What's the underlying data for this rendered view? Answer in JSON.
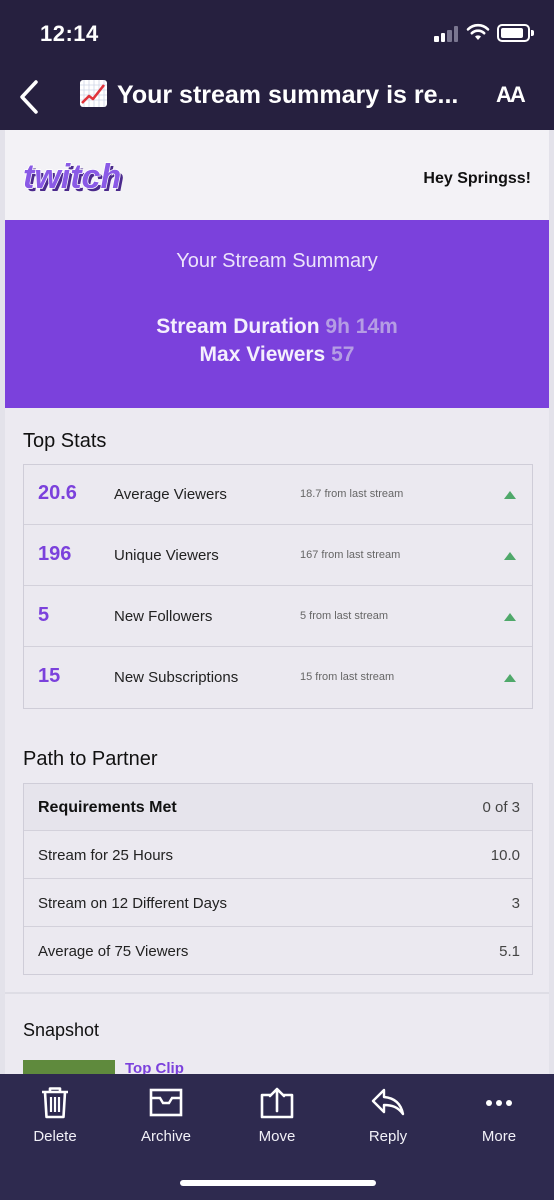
{
  "status_bar": {
    "time": "12:14"
  },
  "header": {
    "subject": "Your stream summary is re...",
    "subject_icon": "chart-increasing-emoji",
    "text_size_label": "AA"
  },
  "email": {
    "logo_name": "twitch-logo",
    "logo_text": "twitch",
    "greeting": "Hey Springss!",
    "hero": {
      "title": "Your Stream Summary",
      "duration_label": "Stream Duration",
      "duration_value": "9h 14m",
      "max_viewers_label": "Max Viewers",
      "max_viewers_value": "57"
    },
    "top_stats_title": "Top Stats",
    "top_stats": [
      {
        "value": "20.6",
        "label": "Average Viewers",
        "previous": "18.7 from last stream",
        "trend": "up"
      },
      {
        "value": "196",
        "label": "Unique Viewers",
        "previous": "167 from last stream",
        "trend": "up"
      },
      {
        "value": "5",
        "label": "New Followers",
        "previous": "5 from last stream",
        "trend": "up"
      },
      {
        "value": "15",
        "label": "New Subscriptions",
        "previous": "15 from last stream",
        "trend": "up"
      }
    ],
    "path_to_partner_title": "Path to Partner",
    "path_to_partner": {
      "header_label": "Requirements Met",
      "header_value": "0 of 3",
      "rows": [
        {
          "label": "Stream for 25 Hours",
          "value": "10.0"
        },
        {
          "label": "Stream on 12 Different Days",
          "value": "3"
        },
        {
          "label": "Average of 75 Viewers",
          "value": "5.1"
        }
      ]
    },
    "snapshot_title": "Snapshot",
    "top_clip_label": "Top Clip"
  },
  "toolbar": {
    "delete_label": "Delete",
    "archive_label": "Archive",
    "move_label": "Move",
    "reply_label": "Reply",
    "more_label": "More"
  },
  "colors": {
    "nav_background": "#26203f",
    "toolbar_background": "#2e2a4f",
    "twitch_purple": "#7b41dc",
    "trend_up_green": "#4fa86a"
  }
}
